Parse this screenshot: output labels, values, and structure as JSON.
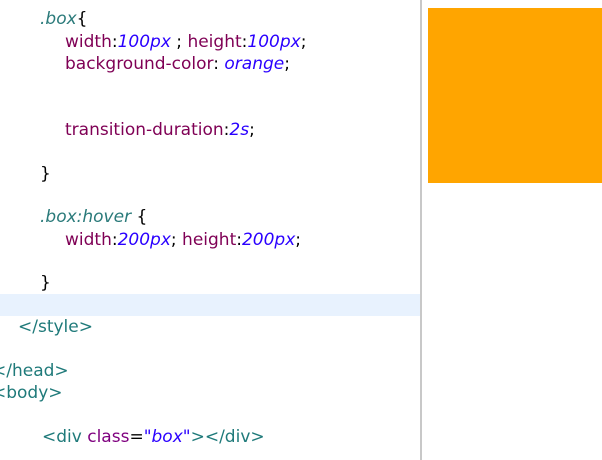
{
  "editor": {
    "lines": [
      {
        "sel": ".box",
        "brace": "{"
      },
      {
        "p1": "width",
        "v1": "100px",
        "sep": " ; ",
        "p2": "height",
        "v2": "100px",
        "end": ";"
      },
      {
        "p1": "background-color",
        "v1": " orange",
        "end": ";"
      },
      {
        "p1": "transition-duration",
        "v1": "2s",
        "end": ";"
      },
      {
        "text": "}"
      },
      {
        "sel": ".box:hover",
        "brace": " {"
      },
      {
        "p1": "width",
        "v1": "200px",
        "sep": "; ",
        "p2": "height",
        "v2": "200px",
        "end": ";"
      },
      {
        "text": "}"
      },
      {
        "text": "</style>"
      },
      {
        "text": "</head>"
      },
      {
        "text": "<body>"
      },
      {
        "open": "<div ",
        "attr": "class",
        "eq": "=",
        "str": "\"box\"",
        "close": "></div>"
      }
    ]
  },
  "preview": {
    "box_color": "#ffa500"
  }
}
